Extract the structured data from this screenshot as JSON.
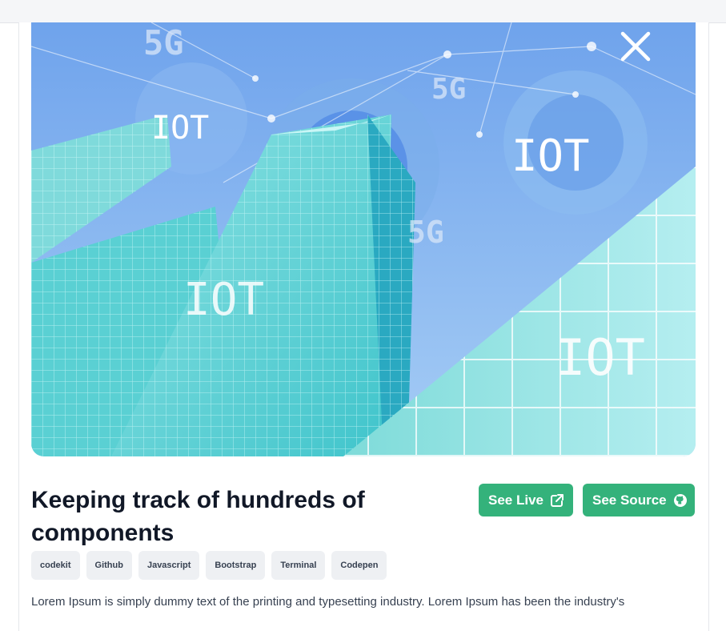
{
  "hero": {
    "overlay_texts": [
      "5G",
      "5G",
      "5G",
      "IOT",
      "IOT",
      "IOT",
      "IOT"
    ]
  },
  "close": {
    "icon": "close-icon"
  },
  "project": {
    "title": "Keeping track of hundreds of components",
    "see_live_label": "See Live",
    "see_source_label": "See Source",
    "tags": [
      "codekit",
      "Github",
      "Javascript",
      "Bootstrap",
      "Terminal",
      "Codepen"
    ],
    "description": "Lorem Ipsum is simply dummy text of the printing and typesetting industry. Lorem Ipsum has been the industry's"
  },
  "colors": {
    "accent": "#34b27b",
    "title": "#111827",
    "tag_bg": "#eef0f3"
  }
}
